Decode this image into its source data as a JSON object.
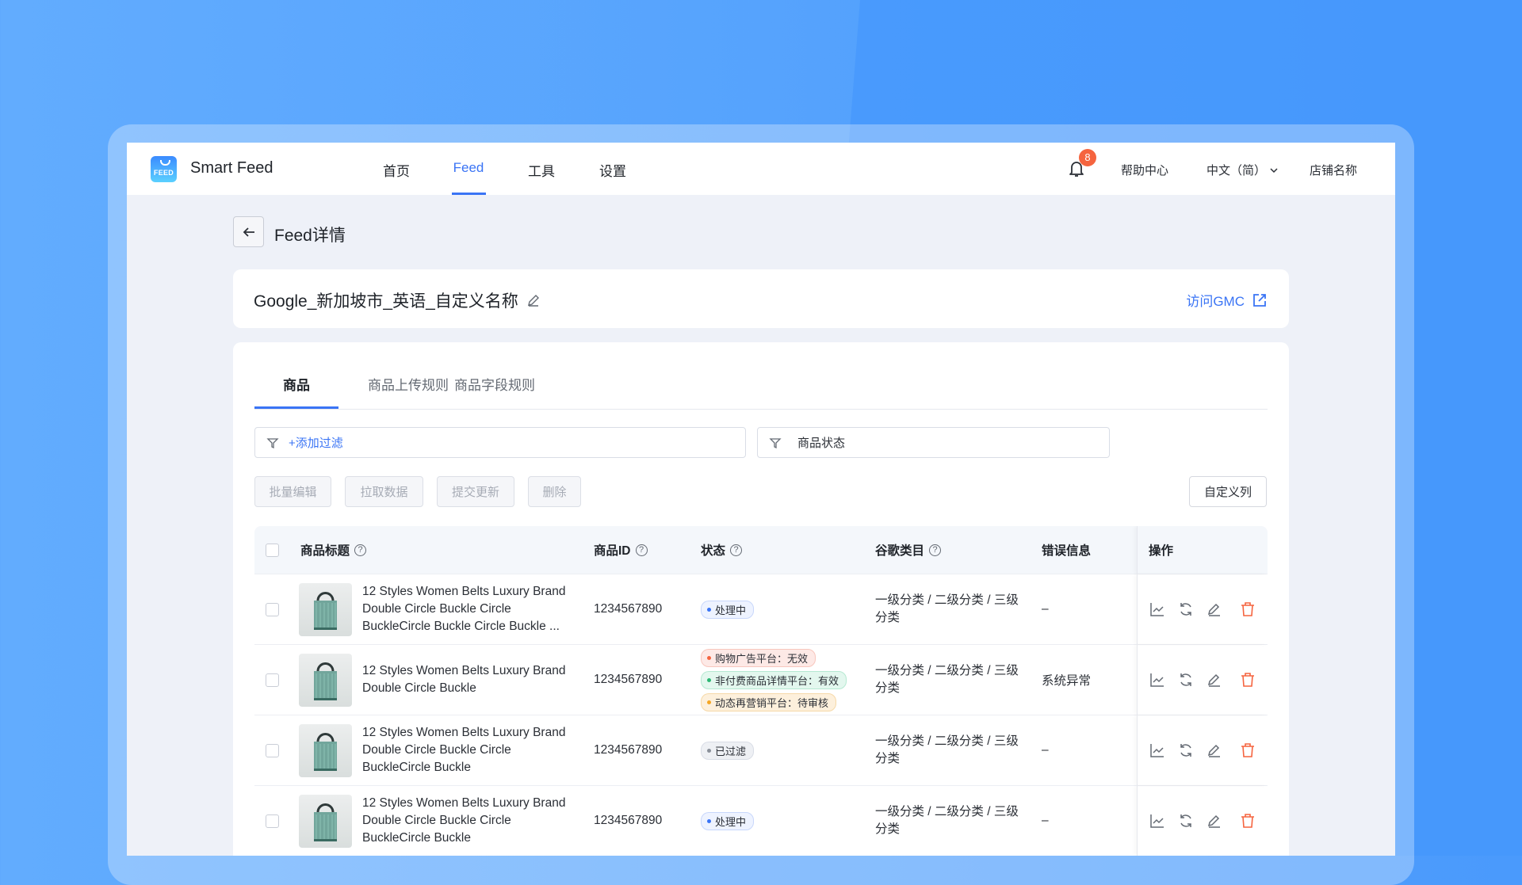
{
  "app": {
    "logo_text": "FEED",
    "name": "Smart Feed"
  },
  "nav": {
    "items": [
      {
        "label": "首页"
      },
      {
        "label": "Feed",
        "active": true
      },
      {
        "label": "工具"
      },
      {
        "label": "设置"
      }
    ]
  },
  "header_right": {
    "notification_count": "8",
    "help": "帮助中心",
    "language": "中文（简）",
    "store": "店铺名称"
  },
  "page": {
    "title": "Feed详情"
  },
  "feed": {
    "name": "Google_新加坡市_英语_自定义名称",
    "visit_link": "访问GMC"
  },
  "tabs": [
    {
      "label": "商品",
      "active": true
    },
    {
      "label": "商品上传规则"
    },
    {
      "label": "商品字段规则"
    }
  ],
  "filters": {
    "add_filter": "+添加过滤",
    "status_filter": "商品状态"
  },
  "actions": {
    "batch_edit": "批量编辑",
    "fetch_data": "拉取数据",
    "submit_update": "提交更新",
    "delete": "删除",
    "custom_columns": "自定义列"
  },
  "colors": {
    "accent": "#3a74f5",
    "danger": "#f5643f"
  },
  "table": {
    "columns": [
      "商品标题",
      "商品ID",
      "状态",
      "谷歌类目",
      "错误信息",
      "操作"
    ],
    "rows": [
      {
        "title": "12 Styles Women Belts Luxury Brand Double Circle Buckle Circle BuckleCircle Buckle Circle Buckle ...",
        "id": "1234567890",
        "statuses": [
          {
            "label": "处理中",
            "type": "info"
          }
        ],
        "category": "一级分类 / 二级分类 / 三级分类",
        "error": "–"
      },
      {
        "title": "12 Styles Women Belts Luxury Brand Double Circle Buckle",
        "id": "1234567890",
        "statuses": [
          {
            "label": "购物广告平台：无效",
            "type": "error"
          },
          {
            "label": "非付费商品详情平台：有效",
            "type": "success"
          },
          {
            "label": "动态再营销平台：待审核",
            "type": "warning"
          }
        ],
        "category": "一级分类 / 二级分类 / 三级分类",
        "error": "系统异常"
      },
      {
        "title": "12 Styles Women Belts Luxury Brand Double Circle Buckle Circle BuckleCircle Buckle",
        "id": "1234567890",
        "statuses": [
          {
            "label": "已过滤",
            "type": "neutral"
          }
        ],
        "category": "一级分类 / 二级分类 / 三级分类",
        "error": "–"
      },
      {
        "title": "12 Styles Women Belts Luxury Brand Double Circle Buckle Circle BuckleCircle Buckle",
        "id": "1234567890",
        "statuses": [
          {
            "label": "处理中",
            "type": "info"
          }
        ],
        "category": "一级分类 / 二级分类 / 三级分类",
        "error": "–"
      }
    ]
  }
}
